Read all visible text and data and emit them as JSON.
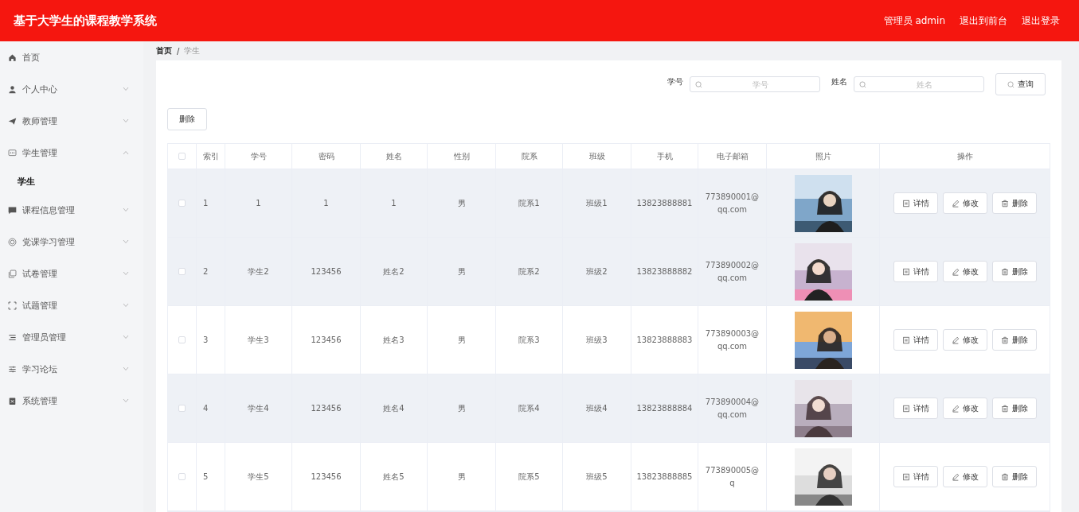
{
  "header": {
    "title": "基于大学生的课程教学系统",
    "links": [
      "管理员 admin",
      "退出到前台",
      "退出登录"
    ]
  },
  "sidebar": {
    "items": [
      {
        "label": "首页"
      },
      {
        "label": "个人中心",
        "expanded": false
      },
      {
        "label": "教师管理",
        "expanded": false
      },
      {
        "label": "学生管理",
        "expanded": true,
        "children": [
          {
            "label": "学生",
            "selected": true
          }
        ]
      },
      {
        "label": "课程信息管理",
        "expanded": false
      },
      {
        "label": "党课学习管理",
        "expanded": false
      },
      {
        "label": "试卷管理",
        "expanded": false
      },
      {
        "label": "试题管理",
        "expanded": false
      },
      {
        "label": "管理员管理",
        "expanded": false
      },
      {
        "label": "学习论坛",
        "expanded": false
      },
      {
        "label": "系统管理",
        "expanded": false
      }
    ]
  },
  "breadcrumb": {
    "items": [
      "首页",
      "学生"
    ],
    "separator": "/"
  },
  "search": {
    "fields": [
      {
        "label": "学号",
        "placeholder": "学号"
      },
      {
        "label": "姓名",
        "placeholder": "姓名"
      }
    ],
    "button": "查询"
  },
  "delete_button": "删除",
  "table": {
    "columns": [
      "索引",
      "学号",
      "密码",
      "姓名",
      "性别",
      "院系",
      "班级",
      "手机",
      "电子邮箱",
      "照片",
      "操作"
    ],
    "all_checked": false,
    "rows": [
      {
        "checked": false,
        "highlighted": true,
        "cells": [
          "1",
          "1",
          "1",
          "1",
          "男",
          "院系1",
          "班级1",
          "13823888881",
          "773890001@qq.com"
        ],
        "actions": [
          "详情",
          "修改",
          "删除"
        ]
      },
      {
        "checked": false,
        "highlighted": true,
        "cells": [
          "2",
          "学生2",
          "123456",
          "姓名2",
          "男",
          "院系2",
          "班级2",
          "13823888882",
          "773890002@qq.com"
        ],
        "actions": [
          "详情",
          "修改",
          "删除"
        ]
      },
      {
        "checked": false,
        "highlighted": false,
        "cells": [
          "3",
          "学生3",
          "123456",
          "姓名3",
          "男",
          "院系3",
          "班级3",
          "13823888883",
          "773890003@qq.com"
        ],
        "actions": [
          "详情",
          "修改",
          "删除"
        ]
      },
      {
        "checked": false,
        "highlighted": true,
        "cells": [
          "4",
          "学生4",
          "123456",
          "姓名4",
          "男",
          "院系4",
          "班级4",
          "13823888884",
          "773890004@qq.com"
        ],
        "actions": [
          "详情",
          "修改",
          "删除"
        ]
      },
      {
        "checked": false,
        "highlighted": false,
        "cells": [
          "5",
          "学生5",
          "123456",
          "姓名5",
          "男",
          "院系5",
          "班级5",
          "13823888885",
          "773890005@q"
        ],
        "actions": [
          "详情",
          "修改",
          "删除"
        ]
      }
    ]
  }
}
